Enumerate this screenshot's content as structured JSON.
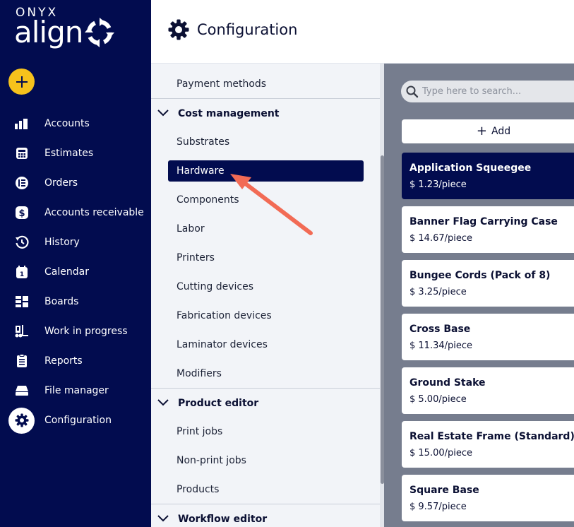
{
  "brand": {
    "top": "ONYX",
    "name": "align"
  },
  "sidebar": {
    "items": [
      {
        "label": "Accounts",
        "icon": "accounts-icon"
      },
      {
        "label": "Estimates",
        "icon": "calculator-icon"
      },
      {
        "label": "Orders",
        "icon": "orders-icon"
      },
      {
        "label": "Accounts receivable",
        "icon": "dollar-icon"
      },
      {
        "label": "History",
        "icon": "history-icon"
      },
      {
        "label": "Calendar",
        "icon": "calendar-icon"
      },
      {
        "label": "Boards",
        "icon": "boards-icon"
      },
      {
        "label": "Work in progress",
        "icon": "forklift-icon"
      },
      {
        "label": "Reports",
        "icon": "clipboard-icon"
      },
      {
        "label": "File manager",
        "icon": "drive-icon"
      },
      {
        "label": "Configuration",
        "icon": "gear-icon",
        "active": true
      }
    ]
  },
  "header": {
    "title": "Configuration"
  },
  "menu": {
    "payment_methods": "Payment methods",
    "cost_management": "Cost management",
    "substrates": "Substrates",
    "hardware": "Hardware",
    "components": "Components",
    "labor": "Labor",
    "printers": "Printers",
    "cutting_devices": "Cutting devices",
    "fabrication_devices": "Fabrication devices",
    "laminator_devices": "Laminator devices",
    "modifiers": "Modifiers",
    "product_editor": "Product editor",
    "print_jobs": "Print jobs",
    "non_print_jobs": "Non-print jobs",
    "products": "Products",
    "workflow_editor": "Workflow editor"
  },
  "panel": {
    "search_placeholder": "Type here to search...",
    "add_label": "Add",
    "items": [
      {
        "name": "Application Squeegee",
        "price": "$ 1.23/piece",
        "selected": true
      },
      {
        "name": "Banner Flag Carrying Case",
        "price": "$ 14.67/piece"
      },
      {
        "name": "Bungee Cords (Pack of 8)",
        "price": "$ 3.25/piece"
      },
      {
        "name": "Cross Base",
        "price": "$ 11.34/piece"
      },
      {
        "name": "Ground Stake",
        "price": "$ 5.00/piece"
      },
      {
        "name": "Real Estate Frame (Standard)",
        "price": "$ 15.00/piece"
      },
      {
        "name": "Square Base",
        "price": "$ 9.57/piece"
      }
    ]
  },
  "colors": {
    "navy": "#020c4f",
    "accent_yellow": "#f6c21c",
    "panel_gray": "#767d8e",
    "menu_bg": "#f2f4f8",
    "annotation_arrow": "#f26b55"
  }
}
